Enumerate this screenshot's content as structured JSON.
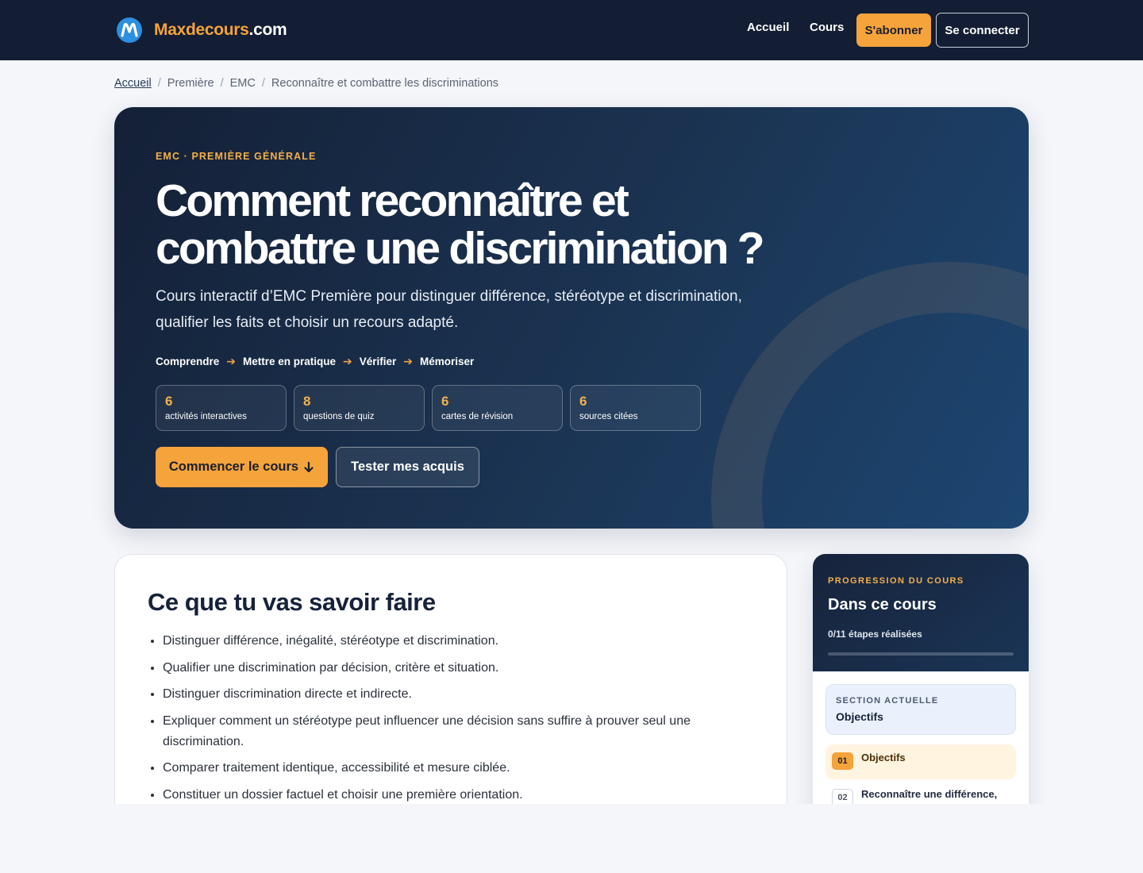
{
  "header": {
    "brand_part1": "Maxdecours",
    "brand_part2": ".com",
    "nav": [
      "Accueil",
      "Cours"
    ],
    "subscribe_label": "S'abonner",
    "login_label": "Se connecter"
  },
  "breadcrumb": [
    "Accueil",
    "Première",
    "EMC",
    "Reconnaître et combattre les discriminations"
  ],
  "hero": {
    "eyebrow": "EMC · PREMIÈRE GÉNÉRALE",
    "title": "Comment reconnaître et combattre une discrimination ?",
    "description": "Cours interactif d’EMC Première pour distinguer différence, stéréotype et discrimination, qualifier les faits et choisir un recours adapté.",
    "steps": [
      "Comprendre",
      "Mettre en pratique",
      "Vérifier",
      "Mémoriser"
    ],
    "stats": [
      {
        "value": "6",
        "label": "activités interactives"
      },
      {
        "value": "8",
        "label": "questions de quiz"
      },
      {
        "value": "6",
        "label": "cartes de révision"
      },
      {
        "value": "6",
        "label": "sources citées"
      }
    ],
    "start_label": "Commencer le cours",
    "test_label": "Tester mes acquis"
  },
  "objectives": {
    "title": "Ce que tu vas savoir faire",
    "items": [
      "Distinguer différence, inégalité, stéréotype et discrimination.",
      "Qualifier une discrimination par décision, critère et situation.",
      "Distinguer discrimination directe et indirecte.",
      "Expliquer comment un stéréotype peut influencer une décision sans suffire à prouver seul une discrimination.",
      "Comparer traitement identique, accessibilité et mesure ciblée.",
      "Constituer un dossier factuel et choisir une première orientation."
    ]
  },
  "progress": {
    "eyebrow": "PROGRESSION DU COURS",
    "title": "Dans ce cours",
    "status": "0/11 étapes réalisées",
    "fraction": 0,
    "current_label": "SECTION ACTUELLE",
    "current_value": "Objectifs",
    "toc": [
      {
        "num": "01",
        "label": "Objectifs"
      },
      {
        "num": "02",
        "label": "Reconnaître une différence,"
      }
    ]
  },
  "colors": {
    "accent": "#f5a33b",
    "navy": "#131d33",
    "brand_blue": "#2d8fe0"
  }
}
